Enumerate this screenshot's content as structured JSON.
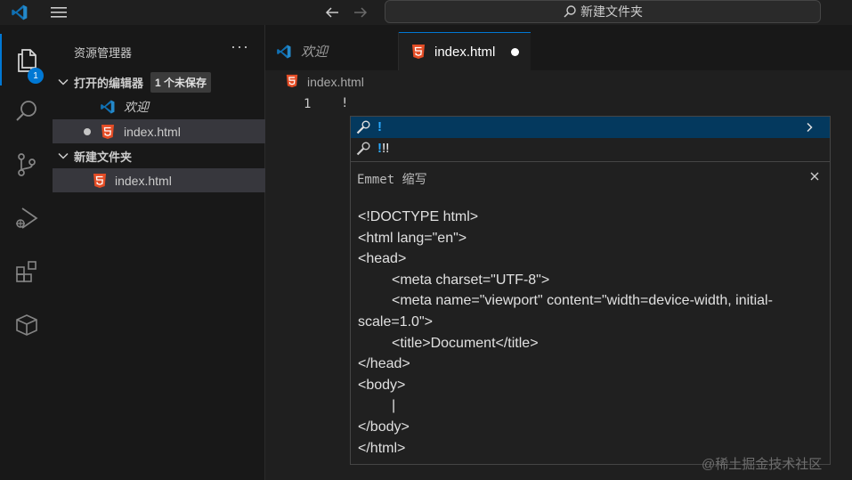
{
  "titlebar": {
    "search_label": "新建文件夹"
  },
  "activitybar": {
    "explorer_badge": "1",
    "accent_color": "#0078d4"
  },
  "sidebar": {
    "title": "资源管理器",
    "more": "···",
    "open_editors": {
      "label": "打开的编辑器",
      "badge": "1 个未保存",
      "items": [
        {
          "label": "欢迎",
          "icon": "vscode-logo-icon"
        },
        {
          "label": "index.html",
          "icon": "html5-icon",
          "unsaved": true
        }
      ]
    },
    "folder": {
      "label": "新建文件夹",
      "items": [
        {
          "label": "index.html",
          "icon": "html5-icon"
        }
      ]
    }
  },
  "tabs": [
    {
      "label": "欢迎",
      "icon": "vscode-logo-icon",
      "active": false
    },
    {
      "label": "index.html",
      "icon": "html5-icon",
      "active": true,
      "unsaved": true
    }
  ],
  "breadcrumb": {
    "file": "index.html"
  },
  "editor": {
    "line_number": "1",
    "line_text": "!"
  },
  "suggest": {
    "items": [
      {
        "highlight": "!",
        "rest": ""
      },
      {
        "highlight": "!",
        "rest": "!!"
      }
    ]
  },
  "details": {
    "title": "Emmet 缩写",
    "lines": [
      "<!DOCTYPE html>",
      "<html lang=\"en\">",
      "<head>",
      "<meta charset=\"UTF-8\">",
      "<meta name=\"viewport\" content=\"width=device-width, initial-",
      "scale=1.0\">",
      "<title>Document</title>",
      "</head>",
      "<body>",
      "|",
      "</body>",
      "</html>"
    ]
  },
  "watermark": "@稀土掘金技术社区"
}
